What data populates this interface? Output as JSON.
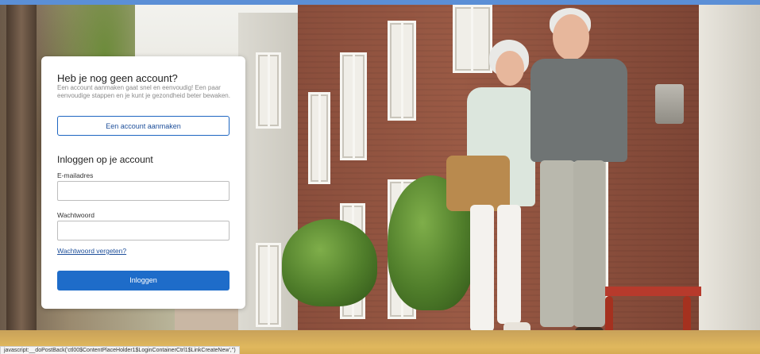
{
  "signup": {
    "heading": "Heb je nog geen account?",
    "intro": "Een account aanmaken gaat snel en eenvoudig! Een paar eenvoudige stappen en je kunt je gezondheid beter bewaken.",
    "create_button": "Een account aanmaken"
  },
  "login": {
    "heading": "Inloggen op je account",
    "email_label": "E-mailadres",
    "email_value": "",
    "password_label": "Wachtwoord",
    "password_value": "",
    "forgot_link": "Wachtwoord vergeten?",
    "submit_button": "Inloggen"
  },
  "status_bar": {
    "text": "javascript:__doPostBack('ctl00$ContentPlaceHolder1$LoginContainerCtrl1$LinkCreateNew','')"
  },
  "colors": {
    "primary": "#1e6cc9",
    "link": "#1e4f9a",
    "top_strip": "#5b8fd6"
  }
}
